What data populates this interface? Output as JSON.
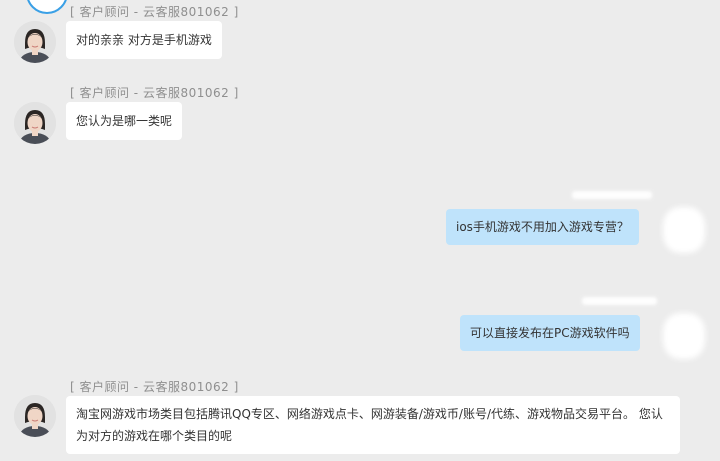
{
  "messages": [
    {
      "from": "agent",
      "sender_label": "[ 客户顾问  -  云客服801062 ]",
      "text": "对的亲亲 对方是手机游戏"
    },
    {
      "from": "agent",
      "sender_label": "[ 客户顾问  -  云客服801062 ]",
      "text": "您认为是哪一类呢"
    },
    {
      "from": "user",
      "text": "ios手机游戏不用加入游戏专营？"
    },
    {
      "from": "user",
      "text": "可以直接发布在PC游戏软件吗"
    },
    {
      "from": "agent",
      "sender_label": "[ 客户顾问  -  云客服801062 ]",
      "text": "淘宝网游戏市场类目包括腾讯QQ专区、网络游戏点卡、网游装备/游戏币/账号/代练、游戏物品交易平台。 您认为对方的游戏在哪个类目的呢"
    }
  ]
}
